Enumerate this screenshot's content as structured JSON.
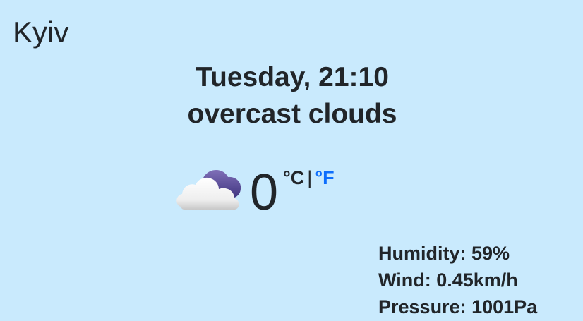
{
  "city": "Kyiv",
  "date_time": "Tuesday, 21:10",
  "description": "overcast clouds",
  "icon": "overcast-clouds-icon",
  "temperature": "0",
  "units": {
    "celsius": "°C",
    "separator": "|",
    "fahrenheit": "°F",
    "active": "celsius"
  },
  "details": {
    "humidity": "Humidity: 59%",
    "wind": "Wind: 0.45km/h",
    "pressure": "Pressure: 1001Pa"
  },
  "colors": {
    "background": "#c9eafd",
    "text": "#212529",
    "link": "#0d6efd"
  }
}
